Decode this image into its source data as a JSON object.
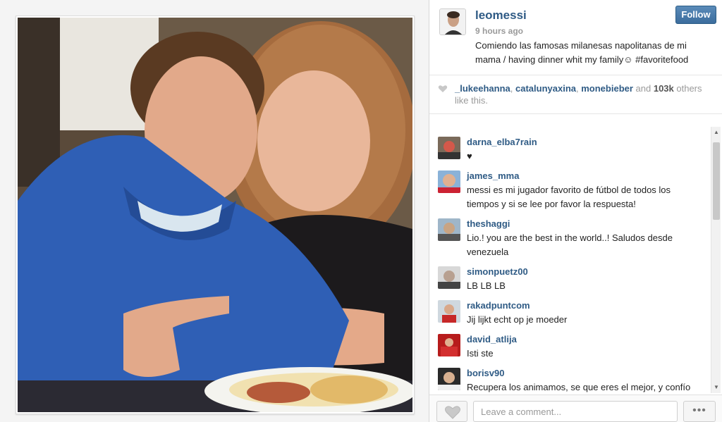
{
  "post": {
    "username": "leomessi",
    "time": "9 hours ago",
    "caption": "Comiendo las famosas milanesas napolitanas de mi mama / having dinner whit my family☺ #favoritefood",
    "follow_label": "Follow"
  },
  "likes": {
    "users": [
      "_lukeehanna",
      "catalunyaxina",
      "monebieber"
    ],
    "sep1": ", ",
    "sep2": ", ",
    "and_text": " and ",
    "count": "103k",
    "suffix": " others like this."
  },
  "comments": [
    {
      "user": "darna_elba7rain",
      "text": "♥"
    },
    {
      "user": "james_mma",
      "text": "messi es mi jugador favorito de fútbol de todos los tiempos y si se lee por favor la respuesta!"
    },
    {
      "user": "theshaggi",
      "text": "Lio.! you are the best in the world..! Saludos desde venezuela"
    },
    {
      "user": "simonpuetz00",
      "text": "LB LB LB"
    },
    {
      "user": "rakadpuntcom",
      "text": "Jij lijkt echt op je moeder"
    },
    {
      "user": "david_atlija",
      "text": "Isti ste"
    },
    {
      "user": "borisv90",
      "text": "Recupera los animamos, se que eres el mejor, y confío"
    }
  ],
  "footer": {
    "comment_placeholder": "Leave a comment...",
    "more_label": "•••"
  },
  "colors": {
    "username": "#2f5b85",
    "follow_button": "#3c6d9d"
  },
  "icons": {
    "like": "heart-icon",
    "more": "more-options-icon"
  }
}
